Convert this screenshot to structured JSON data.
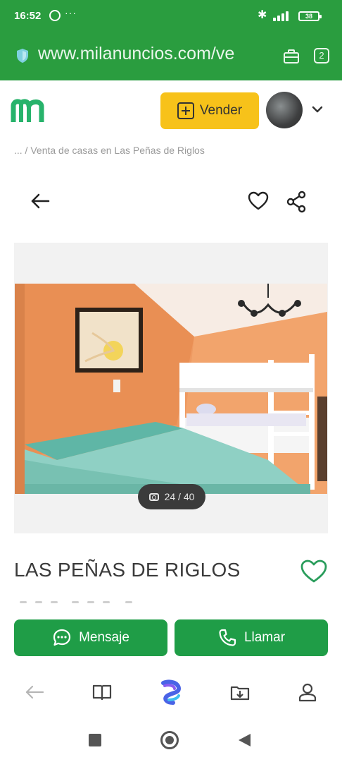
{
  "status_bar": {
    "time": "16:52",
    "notification_dots": "···",
    "battery": "38"
  },
  "url_bar": {
    "url": "www.milanuncios.com/ve",
    "tab_count": "2"
  },
  "header": {
    "logo": "m",
    "sell_button": "Vender"
  },
  "breadcrumb": "... / Venta de casas en Las Peñas de Riglos",
  "gallery": {
    "counter": "24 / 40"
  },
  "listing": {
    "title": "LAS PEÑAS DE RIGLOS"
  },
  "actions": {
    "message": "Mensaje",
    "call": "Llamar"
  },
  "colors": {
    "brand_green": "#2a9d3f",
    "button_green": "#1f9d47",
    "sell_yellow": "#f7c21a"
  }
}
